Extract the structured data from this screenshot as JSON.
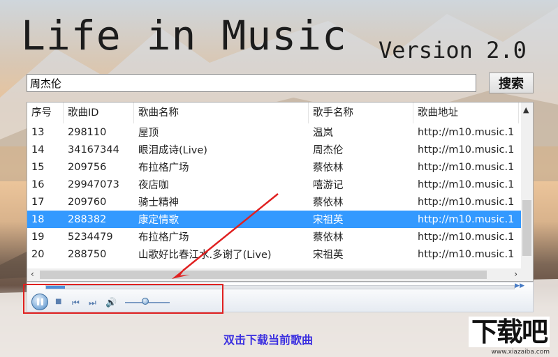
{
  "app": {
    "title": "Life in Music",
    "version": "Version 2.0"
  },
  "search": {
    "value": "周杰伦",
    "button_label": "搜索"
  },
  "table": {
    "columns": [
      "序号",
      "歌曲ID",
      "歌曲名称",
      "歌手名称",
      "歌曲地址"
    ],
    "rows": [
      {
        "no": "13",
        "id": "298110",
        "name": "屋顶",
        "artist": "温岚",
        "url": "http://m10.music.1"
      },
      {
        "no": "14",
        "id": "34167344",
        "name": "眼泪成诗(Live)",
        "artist": "周杰伦",
        "url": "http://m10.music.1"
      },
      {
        "no": "15",
        "id": "209756",
        "name": "布拉格广场",
        "artist": "蔡依林",
        "url": "http://m10.music.1"
      },
      {
        "no": "16",
        "id": "29947073",
        "name": "夜店咖",
        "artist": "嘻游记",
        "url": "http://m10.music.1"
      },
      {
        "no": "17",
        "id": "209760",
        "name": "骑士精神",
        "artist": "蔡依林",
        "url": "http://m10.music.1"
      },
      {
        "no": "18",
        "id": "288382",
        "name": "康定情歌",
        "artist": "宋祖英",
        "url": "http://m10.music.1"
      },
      {
        "no": "19",
        "id": "5234479",
        "name": "布拉格广场",
        "artist": "蔡依林",
        "url": "http://m10.music.1"
      },
      {
        "no": "20",
        "id": "288750",
        "name": "山歌好比春江水.多谢了(Live)",
        "artist": "宋祖英",
        "url": "http://m10.music.1"
      }
    ],
    "selected_row_index": 5
  },
  "player": {
    "seek_progress": 0.04,
    "volume_level": 0.45,
    "icons": [
      "pause-icon",
      "stop-icon",
      "previous-icon",
      "next-icon",
      "volume-icon",
      "fast-forward-icon"
    ]
  },
  "caption": "双击下载当前歌曲",
  "watermark": {
    "logo": "下载吧",
    "url": "www.xiazaiba.com"
  },
  "colors": {
    "selection": "#3399ff",
    "annotation_red": "#e02020",
    "caption_blue": "#3b2fe0"
  }
}
